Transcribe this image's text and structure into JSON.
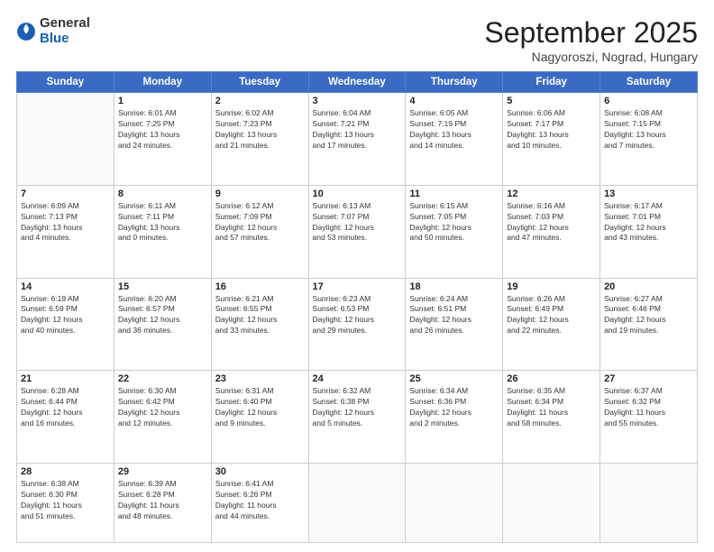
{
  "logo": {
    "general": "General",
    "blue": "Blue"
  },
  "header": {
    "month": "September 2025",
    "location": "Nagyoroszi, Nograd, Hungary"
  },
  "weekdays": [
    "Sunday",
    "Monday",
    "Tuesday",
    "Wednesday",
    "Thursday",
    "Friday",
    "Saturday"
  ],
  "weeks": [
    [
      {
        "day": "",
        "detail": ""
      },
      {
        "day": "1",
        "detail": "Sunrise: 6:01 AM\nSunset: 7:25 PM\nDaylight: 13 hours\nand 24 minutes."
      },
      {
        "day": "2",
        "detail": "Sunrise: 6:02 AM\nSunset: 7:23 PM\nDaylight: 13 hours\nand 21 minutes."
      },
      {
        "day": "3",
        "detail": "Sunrise: 6:04 AM\nSunset: 7:21 PM\nDaylight: 13 hours\nand 17 minutes."
      },
      {
        "day": "4",
        "detail": "Sunrise: 6:05 AM\nSunset: 7:19 PM\nDaylight: 13 hours\nand 14 minutes."
      },
      {
        "day": "5",
        "detail": "Sunrise: 6:06 AM\nSunset: 7:17 PM\nDaylight: 13 hours\nand 10 minutes."
      },
      {
        "day": "6",
        "detail": "Sunrise: 6:08 AM\nSunset: 7:15 PM\nDaylight: 13 hours\nand 7 minutes."
      }
    ],
    [
      {
        "day": "7",
        "detail": "Sunrise: 6:09 AM\nSunset: 7:13 PM\nDaylight: 13 hours\nand 4 minutes."
      },
      {
        "day": "8",
        "detail": "Sunrise: 6:11 AM\nSunset: 7:11 PM\nDaylight: 13 hours\nand 0 minutes."
      },
      {
        "day": "9",
        "detail": "Sunrise: 6:12 AM\nSunset: 7:09 PM\nDaylight: 12 hours\nand 57 minutes."
      },
      {
        "day": "10",
        "detail": "Sunrise: 6:13 AM\nSunset: 7:07 PM\nDaylight: 12 hours\nand 53 minutes."
      },
      {
        "day": "11",
        "detail": "Sunrise: 6:15 AM\nSunset: 7:05 PM\nDaylight: 12 hours\nand 50 minutes."
      },
      {
        "day": "12",
        "detail": "Sunrise: 6:16 AM\nSunset: 7:03 PM\nDaylight: 12 hours\nand 47 minutes."
      },
      {
        "day": "13",
        "detail": "Sunrise: 6:17 AM\nSunset: 7:01 PM\nDaylight: 12 hours\nand 43 minutes."
      }
    ],
    [
      {
        "day": "14",
        "detail": "Sunrise: 6:19 AM\nSunset: 6:59 PM\nDaylight: 12 hours\nand 40 minutes."
      },
      {
        "day": "15",
        "detail": "Sunrise: 6:20 AM\nSunset: 6:57 PM\nDaylight: 12 hours\nand 36 minutes."
      },
      {
        "day": "16",
        "detail": "Sunrise: 6:21 AM\nSunset: 6:55 PM\nDaylight: 12 hours\nand 33 minutes."
      },
      {
        "day": "17",
        "detail": "Sunrise: 6:23 AM\nSunset: 6:53 PM\nDaylight: 12 hours\nand 29 minutes."
      },
      {
        "day": "18",
        "detail": "Sunrise: 6:24 AM\nSunset: 6:51 PM\nDaylight: 12 hours\nand 26 minutes."
      },
      {
        "day": "19",
        "detail": "Sunrise: 6:26 AM\nSunset: 6:49 PM\nDaylight: 12 hours\nand 22 minutes."
      },
      {
        "day": "20",
        "detail": "Sunrise: 6:27 AM\nSunset: 6:46 PM\nDaylight: 12 hours\nand 19 minutes."
      }
    ],
    [
      {
        "day": "21",
        "detail": "Sunrise: 6:28 AM\nSunset: 6:44 PM\nDaylight: 12 hours\nand 16 minutes."
      },
      {
        "day": "22",
        "detail": "Sunrise: 6:30 AM\nSunset: 6:42 PM\nDaylight: 12 hours\nand 12 minutes."
      },
      {
        "day": "23",
        "detail": "Sunrise: 6:31 AM\nSunset: 6:40 PM\nDaylight: 12 hours\nand 9 minutes."
      },
      {
        "day": "24",
        "detail": "Sunrise: 6:32 AM\nSunset: 6:38 PM\nDaylight: 12 hours\nand 5 minutes."
      },
      {
        "day": "25",
        "detail": "Sunrise: 6:34 AM\nSunset: 6:36 PM\nDaylight: 12 hours\nand 2 minutes."
      },
      {
        "day": "26",
        "detail": "Sunrise: 6:35 AM\nSunset: 6:34 PM\nDaylight: 11 hours\nand 58 minutes."
      },
      {
        "day": "27",
        "detail": "Sunrise: 6:37 AM\nSunset: 6:32 PM\nDaylight: 11 hours\nand 55 minutes."
      }
    ],
    [
      {
        "day": "28",
        "detail": "Sunrise: 6:38 AM\nSunset: 6:30 PM\nDaylight: 11 hours\nand 51 minutes."
      },
      {
        "day": "29",
        "detail": "Sunrise: 6:39 AM\nSunset: 6:28 PM\nDaylight: 11 hours\nand 48 minutes."
      },
      {
        "day": "30",
        "detail": "Sunrise: 6:41 AM\nSunset: 6:26 PM\nDaylight: 11 hours\nand 44 minutes."
      },
      {
        "day": "",
        "detail": ""
      },
      {
        "day": "",
        "detail": ""
      },
      {
        "day": "",
        "detail": ""
      },
      {
        "day": "",
        "detail": ""
      }
    ]
  ]
}
